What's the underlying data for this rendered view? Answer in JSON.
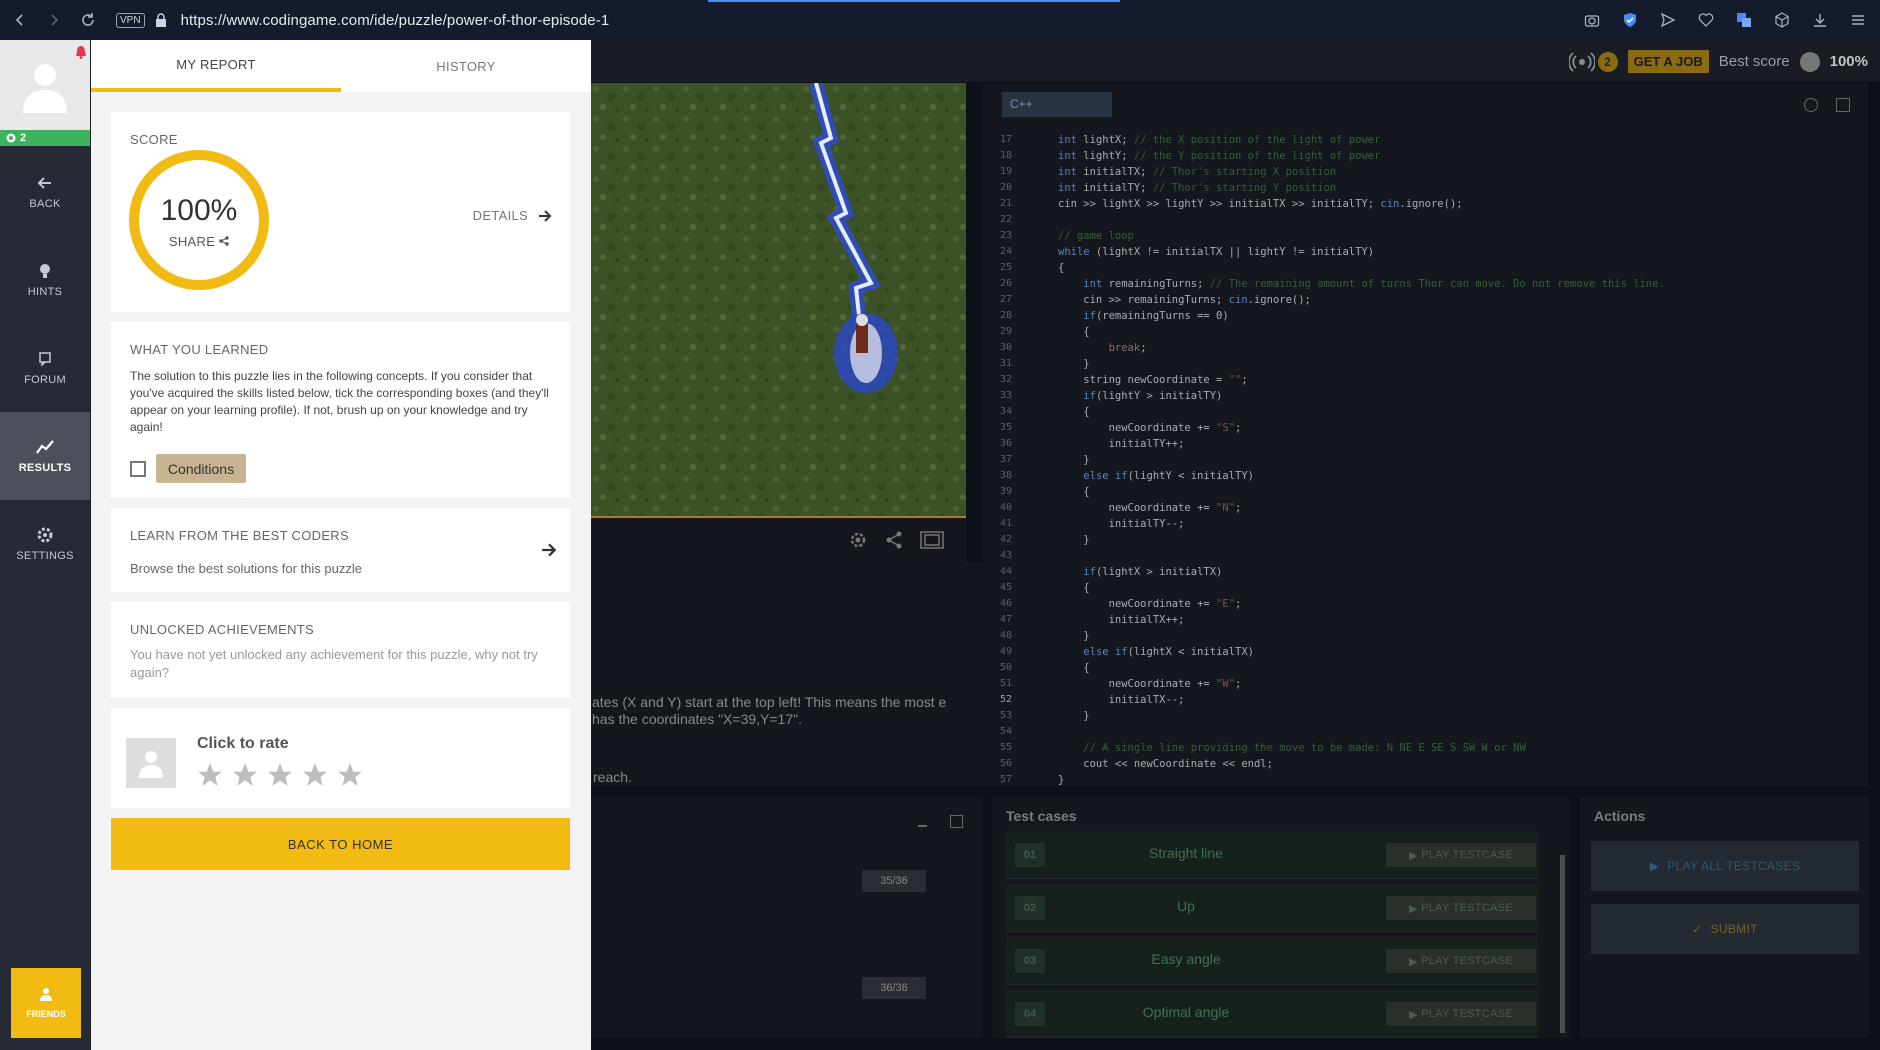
{
  "browser": {
    "vpn_label": "VPN",
    "url": "https://www.codingame.com/ide/puzzle/power-of-thor-episode-1"
  },
  "nav": {
    "level": "2",
    "items": [
      {
        "label": "BACK",
        "icon": "arrow-left-icon"
      },
      {
        "label": "HINTS",
        "icon": "lightbulb-icon"
      },
      {
        "label": "FORUM",
        "icon": "forum-icon"
      },
      {
        "label": "RESULTS",
        "icon": "chart-line-icon"
      },
      {
        "label": "SETTINGS",
        "icon": "gear-icon"
      }
    ],
    "friends_label": "FRIENDS"
  },
  "report": {
    "tabs": [
      "MY REPORT",
      "HISTORY"
    ],
    "score": {
      "title": "SCORE",
      "value": "100%",
      "percent": 100,
      "share_label": "SHARE",
      "details_label": "DETAILS"
    },
    "learned": {
      "title": "WHAT YOU LEARNED",
      "description": "The solution to this puzzle lies in the following concepts. If you consider that you've acquired the skills listed below, tick the corresponding boxes (and they'll appear on your learning profile). If not, brush up on your knowledge and try again!",
      "concept": "Conditions"
    },
    "best_coders": {
      "title": "LEARN FROM THE BEST CODERS",
      "description": "Browse the best solutions for this puzzle"
    },
    "achievements": {
      "title": "UNLOCKED ACHIEVEMENTS",
      "description": "You have not yet unlocked any achievement for this puzzle, why not try again?"
    },
    "rate": {
      "title": "Click to rate",
      "stars": 5
    },
    "back_home_label": "BACK TO HOME"
  },
  "ide": {
    "points": "2",
    "job_label": "GET A JOB",
    "best_score_label": "Best score",
    "best_score_value": "100%",
    "language": "C++",
    "description_text": "ates (X and Y) start at the top left! This means the most e has the coordinates \"X=39,Y=17\".",
    "reach_text": "reach.",
    "console_counts": [
      "35/36",
      "36/36"
    ],
    "line_numbers": [
      "17",
      "18",
      "19",
      "20",
      "21",
      "22",
      "23",
      "24",
      "25",
      "26",
      "27",
      "28",
      "29",
      "30",
      "31",
      "32",
      "33",
      "34",
      "35",
      "36",
      "37",
      "38",
      "39",
      "40",
      "41",
      "42",
      "43",
      "44",
      "45",
      "46",
      "47",
      "48",
      "49",
      "50",
      "51",
      "52",
      "53",
      "54",
      "55",
      "56",
      "57"
    ],
    "test_cases_title": "Test cases",
    "test_cases": [
      {
        "num": "01",
        "name": "Straight line",
        "play": "PLAY TESTCASE"
      },
      {
        "num": "02",
        "name": "Up",
        "play": "PLAY TESTCASE"
      },
      {
        "num": "03",
        "name": "Easy angle",
        "play": "PLAY TESTCASE"
      },
      {
        "num": "04",
        "name": "Optimal angle",
        "play": "PLAY TESTCASE"
      }
    ],
    "actions_title": "Actions",
    "play_all_label": "PLAY ALL TESTCASES",
    "submit_label": "SUBMIT"
  },
  "colors": {
    "accent": "#f2bb13",
    "level_green": "#3eb15c"
  }
}
